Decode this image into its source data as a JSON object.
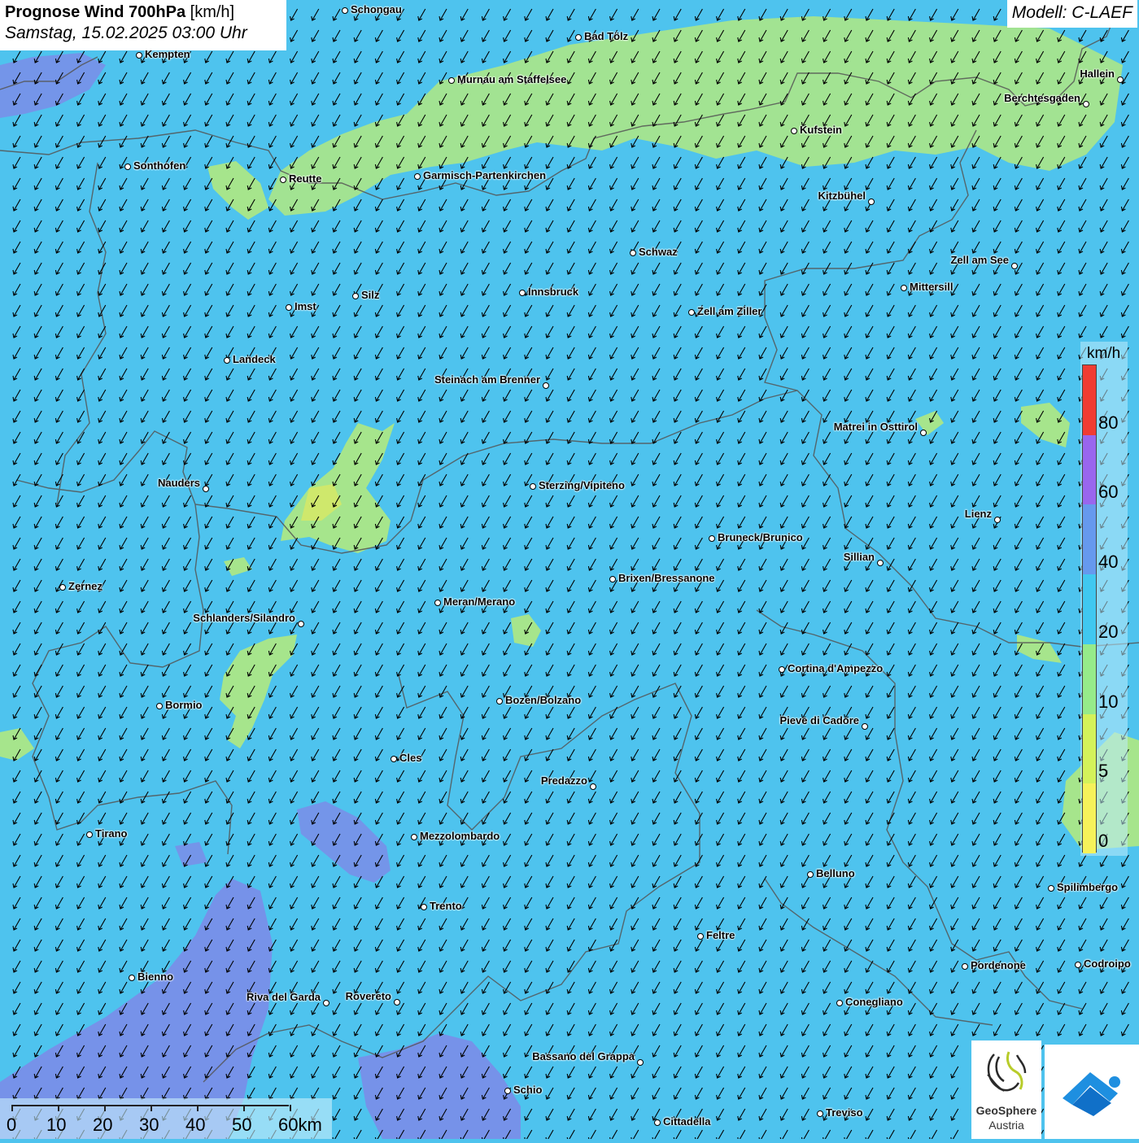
{
  "header": {
    "title_bold": "Prognose Wind 700hPa",
    "title_unit": "[km/h]",
    "datetime": "Samstag, 15.02.2025 03:00 Uhr",
    "model": "Modell: C-LAEF"
  },
  "legend": {
    "unit": "km/h",
    "labels": [
      "80",
      "60",
      "40",
      "20",
      "10",
      "5",
      "0"
    ],
    "colors": [
      "#f03c32",
      "#9966ee",
      "#6699ee",
      "#40c8f0",
      "#96eb8a",
      "#d4f25a",
      "#f6f25a"
    ]
  },
  "scale_bar": {
    "labels": [
      "0",
      "10",
      "20",
      "30",
      "40",
      "50",
      "60km"
    ]
  },
  "logo": {
    "line1": "GeoSphere",
    "line2": "Austria"
  },
  "colors": {
    "background_wind": "#4ec3ee",
    "weak_wind": "#a6e58c",
    "strong_wind": "#7b8de8",
    "border": "#555555"
  },
  "cities": [
    {
      "name": "Schongau"
    },
    {
      "name": "Bad Tölz"
    },
    {
      "name": "Kempten"
    },
    {
      "name": "Murnau am Staffelsee"
    },
    {
      "name": "Hallein"
    },
    {
      "name": "Berchtesgaden"
    },
    {
      "name": "Kufstein"
    },
    {
      "name": "Sonthofen"
    },
    {
      "name": "Reutte"
    },
    {
      "name": "Garmisch-Partenkirchen"
    },
    {
      "name": "Kitzbühel"
    },
    {
      "name": "Schwaz"
    },
    {
      "name": "Zell am See"
    },
    {
      "name": "Mittersill"
    },
    {
      "name": "Silz"
    },
    {
      "name": "Innsbruck"
    },
    {
      "name": "Imst"
    },
    {
      "name": "Zell am Ziller"
    },
    {
      "name": "Landeck"
    },
    {
      "name": "Steinach am Brenner"
    },
    {
      "name": "Matrei in Osttirol"
    },
    {
      "name": "Nauders"
    },
    {
      "name": "Sterzing/Vipiteno"
    },
    {
      "name": "Lienz"
    },
    {
      "name": "Bruneck/Brunico"
    },
    {
      "name": "Sillian"
    },
    {
      "name": "Brixen/Bressanone"
    },
    {
      "name": "Zernez"
    },
    {
      "name": "Meran/Merano"
    },
    {
      "name": "Schlanders/Silandro"
    },
    {
      "name": "Cortina d'Ampezzo"
    },
    {
      "name": "Bozen/Bolzano"
    },
    {
      "name": "Bormio"
    },
    {
      "name": "Pieve di Cadore"
    },
    {
      "name": "Cles"
    },
    {
      "name": "Predazzo"
    },
    {
      "name": "Tirano"
    },
    {
      "name": "Mezzolombardo"
    },
    {
      "name": "Belluno"
    },
    {
      "name": "Spilimbergo"
    },
    {
      "name": "Trento"
    },
    {
      "name": "Feltre"
    },
    {
      "name": "Bienno"
    },
    {
      "name": "Pordenone"
    },
    {
      "name": "Codroipo"
    },
    {
      "name": "Riva del Garda"
    },
    {
      "name": "Rovereto"
    },
    {
      "name": "Conegliano"
    },
    {
      "name": "Bassano del Grappa"
    },
    {
      "name": "Schio"
    },
    {
      "name": "Treviso"
    },
    {
      "name": "Cittadella"
    }
  ]
}
